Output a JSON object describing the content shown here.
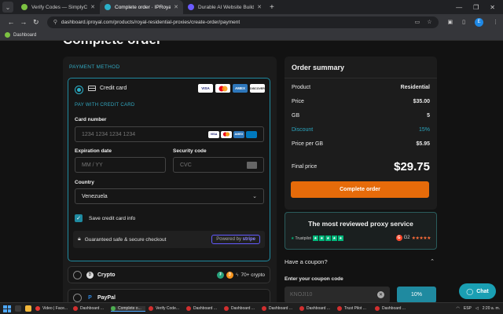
{
  "browser": {
    "tabs": [
      {
        "title": "Verify Codes — SimplyCodes",
        "fav_color": "#7cc242",
        "active": false
      },
      {
        "title": "Complete order · IPRoyal",
        "fav_color": "#2bb0c9",
        "active": true
      },
      {
        "title": "Durable AI Website Builder and...",
        "fav_color": "#6b5bff",
        "active": false
      }
    ],
    "url": "dashboard.iproyal.com/products/royal-residential-proxies/create-order/payment",
    "avatar_letter": "E",
    "bookmark": "Dashboard"
  },
  "page": {
    "title": "Complete order"
  },
  "payment": {
    "section_label": "PAYMENT METHOD",
    "credit_card": {
      "title": "Credit card",
      "brands": [
        "VISA",
        "MC",
        "AMEX",
        "DISCOVER"
      ],
      "pay_with_label": "PAY WITH CREDIT CARD",
      "card_number_label": "Card number",
      "card_number_placeholder": "1234 1234 1234 1234",
      "expiration_label": "Expiration date",
      "expiration_placeholder": "MM / YY",
      "security_label": "Security code",
      "security_placeholder": "CVC",
      "country_label": "Country",
      "country_value": "Venezuela",
      "save_label": "Save credit card info",
      "secure_text": "Guaranteed safe & secure checkout",
      "powered_by": "Powered by",
      "stripe": "stripe"
    },
    "crypto": {
      "label": "Crypto",
      "more": "70+ crypto"
    },
    "paypal": {
      "label": "PayPal"
    }
  },
  "summary": {
    "title": "Order summary",
    "rows": [
      {
        "label": "Product",
        "value": "Residential"
      },
      {
        "label": "Price",
        "value": "$35.00"
      },
      {
        "label": "GB",
        "value": "5"
      },
      {
        "label": "Discount",
        "value": "15%"
      },
      {
        "label": "Price per GB",
        "value": "$5.95"
      }
    ],
    "final_label": "Final price",
    "final_value": "$29.75",
    "complete_button": "Complete order"
  },
  "reviews": {
    "title": "The most reviewed proxy service",
    "trustpilot": "Trustpilot",
    "g2": "G2"
  },
  "coupon": {
    "question": "Have a coupon?",
    "label": "Enter your coupon code",
    "value": "KNOJI10",
    "percent": "10%"
  },
  "chat": {
    "label": "Chat"
  },
  "taskbar": {
    "items": [
      "Video | Face...",
      "Dashboard ...",
      "Complete o...",
      "Verify Code...",
      "Dashboard ...",
      "Dashboard ...",
      "Dashboard ...",
      "Dashboard ...",
      "Trust Pilot ...",
      "Dashboard ..."
    ],
    "lang": "ESP",
    "time": "2:20 a. m."
  }
}
